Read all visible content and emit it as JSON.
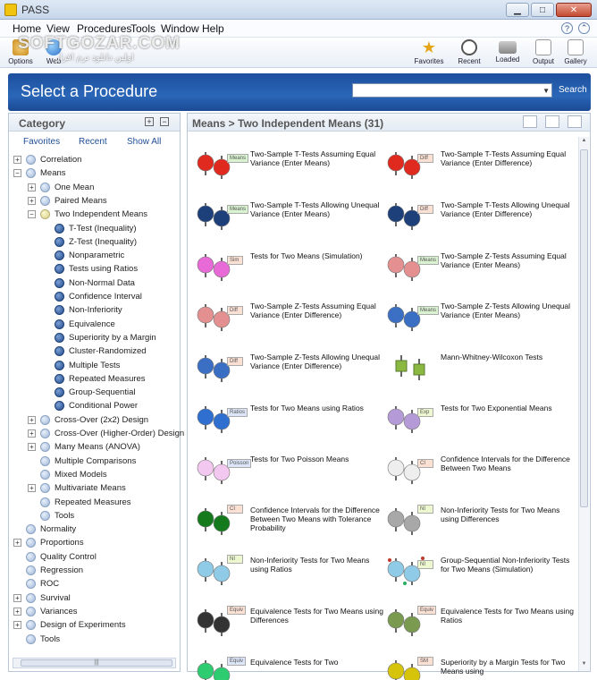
{
  "window": {
    "title": "PASS"
  },
  "menu": [
    "Home",
    "View",
    "Procedures",
    "Tools",
    "Window",
    "Help"
  ],
  "toolbar": {
    "left": [
      {
        "label": "Options"
      },
      {
        "label": "Web"
      }
    ],
    "right": [
      {
        "label": "Favorites"
      },
      {
        "label": "Recent"
      },
      {
        "label": "Loaded"
      },
      {
        "label": "Output"
      },
      {
        "label": "Gallery"
      }
    ]
  },
  "watermark": {
    "line1": "SOFTGOZAR.COM",
    "line2": "اولین دانلود نرم افزار"
  },
  "header": {
    "title": "Select a Procedure",
    "search_value": "",
    "search_label": "Search"
  },
  "category": {
    "title": "Category",
    "expand_all": "+",
    "collapse_all": "−",
    "tabs": [
      "Favorites",
      "Recent",
      "Show All"
    ],
    "tree": [
      {
        "label": "Correlation",
        "level": 0,
        "exp": "+",
        "dot": "lite"
      },
      {
        "label": "Means",
        "level": 0,
        "exp": "−",
        "dot": "lite"
      },
      {
        "label": "One Mean",
        "level": 1,
        "exp": "+",
        "dot": "lite"
      },
      {
        "label": "Paired Means",
        "level": 1,
        "exp": "+",
        "dot": "lite"
      },
      {
        "label": "Two Independent Means",
        "level": 1,
        "exp": "−",
        "dot": "yel"
      },
      {
        "label": "T-Test (Inequality)",
        "level": 2,
        "exp": "",
        "dot": "dark"
      },
      {
        "label": "Z-Test (Inequality)",
        "level": 2,
        "exp": "",
        "dot": "dark"
      },
      {
        "label": "Nonparametric",
        "level": 2,
        "exp": "",
        "dot": "dark"
      },
      {
        "label": "Tests using Ratios",
        "level": 2,
        "exp": "",
        "dot": "dark"
      },
      {
        "label": "Non-Normal Data",
        "level": 2,
        "exp": "",
        "dot": "dark"
      },
      {
        "label": "Confidence Interval",
        "level": 2,
        "exp": "",
        "dot": "dark"
      },
      {
        "label": "Non-Inferiority",
        "level": 2,
        "exp": "",
        "dot": "dark"
      },
      {
        "label": "Equivalence",
        "level": 2,
        "exp": "",
        "dot": "dark"
      },
      {
        "label": "Superiority by a Margin",
        "level": 2,
        "exp": "",
        "dot": "dark"
      },
      {
        "label": "Cluster-Randomized",
        "level": 2,
        "exp": "",
        "dot": "dark"
      },
      {
        "label": "Multiple Tests",
        "level": 2,
        "exp": "",
        "dot": "dark"
      },
      {
        "label": "Repeated Measures",
        "level": 2,
        "exp": "",
        "dot": "dark"
      },
      {
        "label": "Group-Sequential",
        "level": 2,
        "exp": "",
        "dot": "dark"
      },
      {
        "label": "Conditional Power",
        "level": 2,
        "exp": "",
        "dot": "dark"
      },
      {
        "label": "Cross-Over (2x2) Design",
        "level": 1,
        "exp": "+",
        "dot": "lite"
      },
      {
        "label": "Cross-Over (Higher-Order) Design",
        "level": 1,
        "exp": "+",
        "dot": "lite"
      },
      {
        "label": "Many Means (ANOVA)",
        "level": 1,
        "exp": "+",
        "dot": "lite"
      },
      {
        "label": "Multiple Comparisons",
        "level": 1,
        "exp": "",
        "dot": "lite"
      },
      {
        "label": "Mixed Models",
        "level": 1,
        "exp": "",
        "dot": "lite"
      },
      {
        "label": "Multivariate Means",
        "level": 1,
        "exp": "+",
        "dot": "lite"
      },
      {
        "label": "Repeated Measures",
        "level": 1,
        "exp": "",
        "dot": "lite"
      },
      {
        "label": "Tools",
        "level": 1,
        "exp": "",
        "dot": "lite"
      },
      {
        "label": "Normality",
        "level": 0,
        "exp": "",
        "dot": "lite"
      },
      {
        "label": "Proportions",
        "level": 0,
        "exp": "+",
        "dot": "lite"
      },
      {
        "label": "Quality Control",
        "level": 0,
        "exp": "",
        "dot": "lite"
      },
      {
        "label": "Regression",
        "level": 0,
        "exp": "",
        "dot": "lite"
      },
      {
        "label": "ROC",
        "level": 0,
        "exp": "",
        "dot": "lite"
      },
      {
        "label": "Survival",
        "level": 0,
        "exp": "+",
        "dot": "lite"
      },
      {
        "label": "Variances",
        "level": 0,
        "exp": "+",
        "dot": "lite"
      },
      {
        "label": "Design of Experiments",
        "level": 0,
        "exp": "+",
        "dot": "lite"
      },
      {
        "label": "Tools",
        "level": 0,
        "exp": "",
        "dot": "lite"
      }
    ],
    "scroll_thumb": "|||"
  },
  "procedures": {
    "breadcrumb": "Means > Two Independent Means (31)",
    "items": [
      {
        "label": "Two-Sample T-Tests Assuming Equal Variance (Enter Means)",
        "color": "#e02a20",
        "tag": "Means",
        "tagcolor": "#d9f2d0",
        "icon": "pair"
      },
      {
        "label": "Two-Sample T-Tests Assuming Equal Variance (Enter Difference)",
        "color": "#e02a20",
        "tag": "Diff",
        "tagcolor": "#fbe0d4",
        "icon": "pair"
      },
      {
        "label": "Two-Sample T-Tests Allowing Unequal Variance (Enter Means)",
        "color": "#1d3f7a",
        "tag": "Means",
        "tagcolor": "#d9f2d0",
        "icon": "pair"
      },
      {
        "label": "Two-Sample T-Tests Allowing Unequal Variance (Enter Difference)",
        "color": "#1d3f7a",
        "tag": "Diff",
        "tagcolor": "#fbe0d4",
        "icon": "pair"
      },
      {
        "label": "Tests for Two Means (Simulation)",
        "color": "#e86ad6",
        "tag": "Sim",
        "tagcolor": "#fbe0d4",
        "icon": "pair"
      },
      {
        "label": "Two-Sample Z-Tests Assuming Equal Variance (Enter Means)",
        "color": "#e59090",
        "tag": "Means",
        "tagcolor": "#d9f2d0",
        "icon": "pair"
      },
      {
        "label": "Two-Sample Z-Tests Assuming Equal Variance (Enter Difference)",
        "color": "#e59090",
        "tag": "Diff",
        "tagcolor": "#fbe0d4",
        "icon": "pair"
      },
      {
        "label": "Two-Sample Z-Tests Allowing Unequal Variance (Enter Means)",
        "color": "#3b6fc4",
        "tag": "Means",
        "tagcolor": "#d9f2d0",
        "icon": "pair"
      },
      {
        "label": "Two-Sample Z-Tests Allowing Unequal Variance (Enter Difference)",
        "color": "#3b6fc4",
        "tag": "Diff",
        "tagcolor": "#fbe0d4",
        "icon": "pair"
      },
      {
        "label": "Mann-Whitney-Wilcoxon Tests",
        "color": "#8ab840",
        "tag": "",
        "tagcolor": "",
        "icon": "box"
      },
      {
        "label": "Tests for Two Means using Ratios",
        "color": "#2f6fd0",
        "tag": "Ratios",
        "tagcolor": "#dce6f8",
        "icon": "pair"
      },
      {
        "label": "Tests for Two Exponential Means",
        "color": "#b49ad6",
        "tag": "Exp",
        "tagcolor": "#eef8d0",
        "icon": "pair"
      },
      {
        "label": "Tests for Two Poisson Means",
        "color": "#f3c8f0",
        "tag": "Poisson",
        "tagcolor": "#dce6f8",
        "icon": "pair"
      },
      {
        "label": "Confidence Intervals for the Difference Between Two Means",
        "color": "#eeeeee",
        "tag": "CI",
        "tagcolor": "#fbe0d4",
        "icon": "pair"
      },
      {
        "label": "Confidence Intervals for the Difference Between Two Means with Tolerance Probability",
        "color": "#157a1c",
        "tag": "CI",
        "tagcolor": "#fbe0d4",
        "icon": "pair2"
      },
      {
        "label": "Non-Inferiority Tests for Two Means using Differences",
        "color": "#a8a8a8",
        "tag": "NI",
        "tagcolor": "#eef8d0",
        "icon": "pair2"
      },
      {
        "label": "Non-Inferiority Tests for Two Means using Ratios",
        "color": "#8fcbe6",
        "tag": "NI",
        "tagcolor": "#eef8d0",
        "icon": "pair2"
      },
      {
        "label": "Group-Sequential Non-Inferiority Tests for Two Means (Simulation)",
        "color": "#8fcbe6",
        "tag": "NI",
        "tagcolor": "#eef8d0",
        "icon": "gs"
      },
      {
        "label": "Equivalence Tests for Two Means using Differences",
        "color": "#333333",
        "tag": "Equiv",
        "tagcolor": "#fbe0d4",
        "icon": "pair2"
      },
      {
        "label": "Equivalence Tests for Two Means using Ratios",
        "color": "#7a9a50",
        "tag": "Equiv",
        "tagcolor": "#fbe0d4",
        "icon": "pair2"
      },
      {
        "label": "Equivalence Tests for Two",
        "color": "#2ecc71",
        "tag": "Equiv",
        "tagcolor": "#dce6f8",
        "icon": "pair2"
      },
      {
        "label": "Superiority by a Margin Tests for Two Means using",
        "color": "#d6c40a",
        "tag": "SM",
        "tagcolor": "#fbe0d4",
        "icon": "pair2"
      }
    ]
  }
}
